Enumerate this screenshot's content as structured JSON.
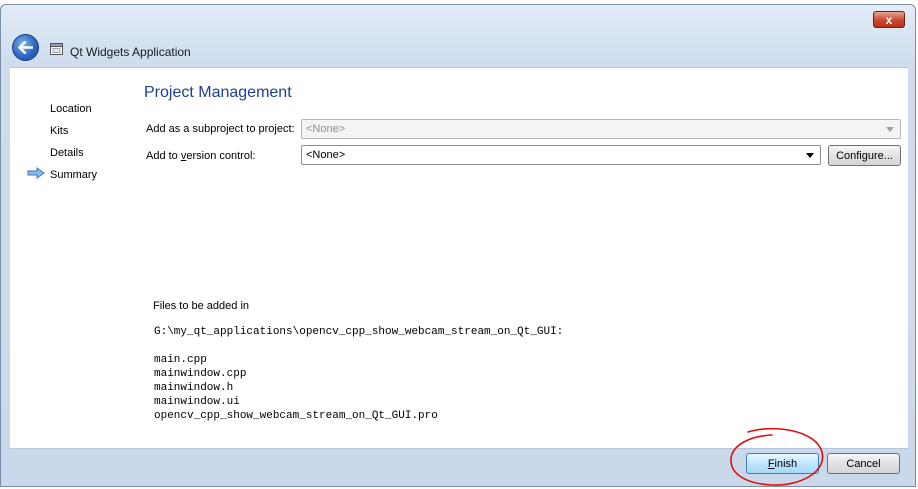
{
  "window": {
    "title": "Qt Widgets Application",
    "close_glyph": "x"
  },
  "sidebar": {
    "items": [
      {
        "label": "Location"
      },
      {
        "label": "Kits"
      },
      {
        "label": "Details"
      },
      {
        "label": "Summary",
        "current": true
      }
    ]
  },
  "main": {
    "title": "Project Management",
    "subproject": {
      "label": "Add as a subproject to project:",
      "value": "<None>",
      "enabled": false
    },
    "version_control": {
      "label_prefix": "Add to ",
      "label_accel": "v",
      "label_rest": "ersion control:",
      "value": "<None>",
      "configure_label": "Configure..."
    },
    "files": {
      "heading": "Files to be added in",
      "path": "G:\\my_qt_applications\\opencv_cpp_show_webcam_stream_on_Qt_GUI:",
      "list": [
        "main.cpp",
        "mainwindow.cpp",
        "mainwindow.h",
        "mainwindow.ui",
        "opencv_cpp_show_webcam_stream_on_Qt_GUI.pro"
      ]
    }
  },
  "footer": {
    "finish_accel": "F",
    "finish_rest": "inish",
    "cancel_label": "Cancel"
  },
  "colors": {
    "title_blue": "#1e3f8f",
    "annotation_red": "#e01010",
    "close_red": "#c7492f"
  },
  "icons": {
    "back": "back-arrow-icon",
    "app": "app-window-icon",
    "current_step": "current-step-arrow-icon",
    "close": "close-icon"
  }
}
